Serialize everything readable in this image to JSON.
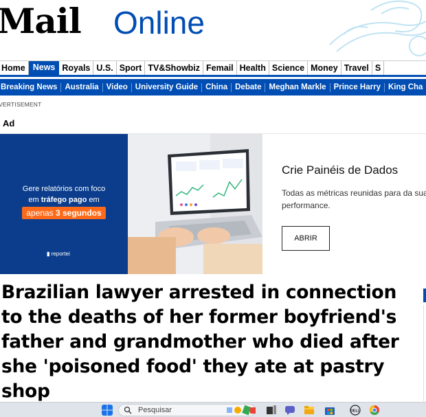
{
  "masthead": {
    "logo_mail": "Mail",
    "logo_online": "Online"
  },
  "nav_primary": [
    {
      "label": "Home",
      "active": false
    },
    {
      "label": "News",
      "active": true
    },
    {
      "label": "Royals",
      "active": false
    },
    {
      "label": "U.S.",
      "active": false
    },
    {
      "label": "Sport",
      "active": false
    },
    {
      "label": "TV&Showbiz",
      "active": false
    },
    {
      "label": "Femail",
      "active": false
    },
    {
      "label": "Health",
      "active": false
    },
    {
      "label": "Science",
      "active": false
    },
    {
      "label": "Money",
      "active": false
    },
    {
      "label": "Travel",
      "active": false
    },
    {
      "label": "S",
      "active": false
    }
  ],
  "nav_secondary": [
    "Breaking News",
    "Australia",
    "Video",
    "University Guide",
    "China",
    "Debate",
    "Meghan Markle",
    "Prince Harry",
    "King Cha"
  ],
  "ad": {
    "advertisement_label": "VERTISEMENT",
    "ad_label": "Ad",
    "left_line1": "Gere relatórios com foco",
    "left_line2_prefix": "em ",
    "left_line2_bold": "tráfego pago",
    "left_line2_suffix": " em",
    "pill_prefix": "apenas ",
    "pill_bold": "3 segundos",
    "brand": "reportei",
    "title": "Crie Painéis de Dados",
    "description": "Todas as métricas reunidas para da sua performance.",
    "cta": "ABRIR"
  },
  "article": {
    "headline": "Brazilian lawyer arrested in connection to the deaths of her former boyfriend's father and grandmother who died after she 'poisoned food' they ate at pastry shop"
  },
  "taskbar": {
    "search_placeholder": "Pesquisar",
    "icons": [
      "windows-start-icon",
      "search-icon",
      "widgets-icon",
      "task-view-icon",
      "chat-icon",
      "file-explorer-icon",
      "store-icon",
      "dell-icon",
      "chrome-icon"
    ]
  },
  "colors": {
    "brand_blue": "#004db3",
    "ad_navy": "#0b3d8c",
    "ad_orange": "#ff6a1a"
  }
}
